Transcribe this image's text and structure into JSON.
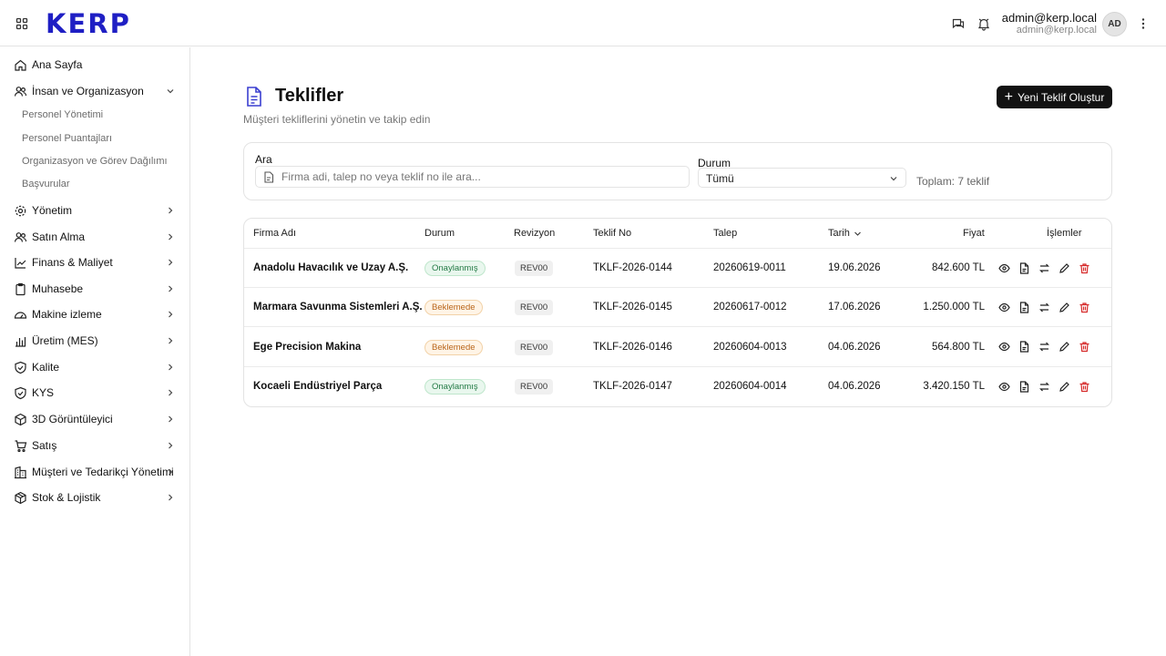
{
  "header": {
    "logo": "KERP",
    "user_name": "admin@kerp.local",
    "user_email": "admin@kerp.local",
    "avatar_initials": "AD"
  },
  "sidebar": {
    "items": [
      {
        "label": "Ana Sayfa",
        "icon": "home-icon"
      },
      {
        "label": "İnsan ve Organizasyon",
        "icon": "users-icon",
        "expanded": true,
        "children": [
          "Personel Yönetimi",
          "Personel Puantajları",
          "Organizasyon ve Görev Dağılımı",
          "Başvurular"
        ]
      },
      {
        "label": "Yönetim",
        "icon": "gear-icon"
      },
      {
        "label": "Satın Alma",
        "icon": "users-icon"
      },
      {
        "label": "Finans & Maliyet",
        "icon": "chart-icon"
      },
      {
        "label": "Muhasebe",
        "icon": "clipboard-icon"
      },
      {
        "label": "Makine izleme",
        "icon": "gauge-icon"
      },
      {
        "label": "Üretim (MES)",
        "icon": "bar-chart-icon"
      },
      {
        "label": "Kalite",
        "icon": "shield-check-icon"
      },
      {
        "label": "KYS",
        "icon": "shield-check-icon"
      },
      {
        "label": "3D Görüntüleyici",
        "icon": "cube-icon"
      },
      {
        "label": "Satış",
        "icon": "cart-icon"
      },
      {
        "label": "Müşteri ve Tedarikçi Yönetimi",
        "icon": "building-icon"
      },
      {
        "label": "Stok & Lojistik",
        "icon": "package-icon"
      }
    ]
  },
  "page": {
    "title": "Teklifler",
    "subtitle": "Müşteri tekliflerini yönetin ve takip edin",
    "new_button": "Yeni Teklif Oluştur"
  },
  "filters": {
    "search_label": "Ara",
    "search_placeholder": "Firma adi, talep no veya teklif no ile ara...",
    "status_label": "Durum",
    "status_value": "Tümü",
    "total_text": "Toplam: 7 teklif"
  },
  "table": {
    "headers": {
      "firm": "Firma Adı",
      "status": "Durum",
      "revision": "Revizyon",
      "offer_no": "Teklif No",
      "request": "Talep",
      "date": "Tarih",
      "price": "Fiyat",
      "actions": "İşlemler"
    },
    "rows": [
      {
        "firm": "Anadolu Havacılık ve Uzay A.Ş.",
        "status": "Onaylanmış",
        "status_type": "ok",
        "revision": "REV00",
        "offer_no": "TKLF-2026-0144",
        "request": "20260619-0011",
        "date": "19.06.2026",
        "price": "842.600 TL"
      },
      {
        "firm": "Marmara Savunma Sistemleri A.Ş.",
        "status": "Beklemede",
        "status_type": "wait",
        "revision": "REV00",
        "offer_no": "TKLF-2026-0145",
        "request": "20260617-0012",
        "date": "17.06.2026",
        "price": "1.250.000 TL"
      },
      {
        "firm": "Ege Precision Makina",
        "status": "Beklemede",
        "status_type": "wait",
        "revision": "REV00",
        "offer_no": "TKLF-2026-0146",
        "request": "20260604-0013",
        "date": "04.06.2026",
        "price": "564.800 TL"
      },
      {
        "firm": "Kocaeli Endüstriyel Parça",
        "status": "Onaylanmış",
        "status_type": "ok",
        "revision": "REV00",
        "offer_no": "TKLF-2026-0147",
        "request": "20260604-0014",
        "date": "04.06.2026",
        "price": "3.420.150 TL"
      }
    ]
  },
  "colors": {
    "brand": "#1f1fc4",
    "approved_bg": "#e9f7ee",
    "approved_text": "#237a45",
    "pending_bg": "#fff4e6",
    "pending_text": "#b9651a",
    "delete": "#d62a2a"
  }
}
